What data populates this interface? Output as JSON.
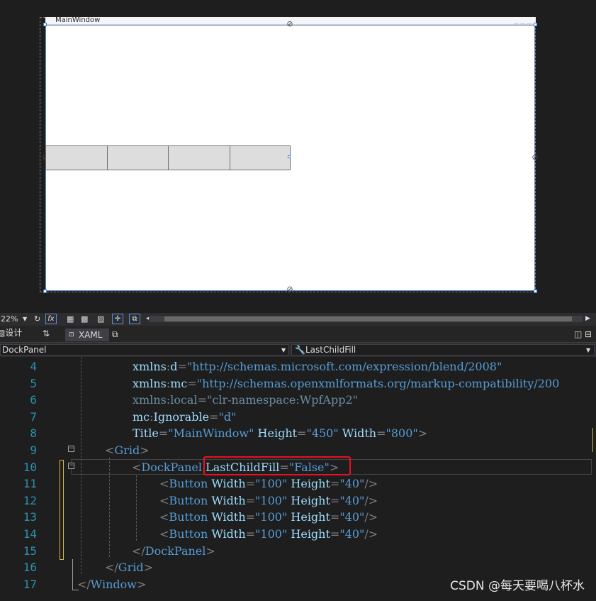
{
  "designer": {
    "window_title": "MainWindow",
    "buttons": [
      "",
      "",
      "",
      ""
    ]
  },
  "toolbar": {
    "zoom": "22%",
    "fx_label": "fx"
  },
  "tabs": {
    "design_label": "设计",
    "swap_label": "⇅",
    "xaml_label": "XAML"
  },
  "navbar": {
    "element_combo": "DockPanel",
    "member_combo": "LastChildFill"
  },
  "editor": {
    "line_numbers": [
      "4",
      "5",
      "6",
      "7",
      "8",
      "9",
      "10",
      "11",
      "12",
      "13",
      "14",
      "15",
      "16",
      "17"
    ],
    "lines": [
      {
        "p1": "xmlns",
        "c": ":",
        "p2": "d",
        "eq": "=",
        "v": "\"http://schemas.microsoft.com/expression/blend/2008\""
      },
      {
        "p1": "xmlns",
        "c": ":",
        "p2": "mc",
        "eq": "=",
        "v": "\"http://schemas.openxmlformats.org/markup-compatibility/200"
      },
      {
        "p1": "xmlns",
        "c": ":",
        "p2": "local",
        "eq": "=",
        "v": "\"clr-namespace:WpfApp2\""
      },
      {
        "p1": "mc",
        "c": ":",
        "p2": "Ignorable",
        "eq": "=",
        "v": "\"d\""
      },
      {
        "a1": "Title",
        "v1": "\"MainWindow\"",
        "a2": "Height",
        "v2": "\"450\"",
        "a3": "Width",
        "v3": "\"800\"",
        "end": ">"
      },
      {
        "open": "<",
        "tag": "Grid",
        "close": ">"
      },
      {
        "open": "<",
        "tag": "DockPanel",
        "attr": "LastChildFill",
        "eq": "=",
        "v": "\"False\"",
        "close": ">"
      },
      {
        "open": "<",
        "tag": "Button",
        "a1": "Width",
        "v1": "\"100\"",
        "a2": "Height",
        "v2": "\"40\"",
        "close": "/>"
      },
      {
        "open": "<",
        "tag": "Button",
        "a1": "Width",
        "v1": "\"100\"",
        "a2": "Height",
        "v2": "\"40\"",
        "close": "/>"
      },
      {
        "open": "<",
        "tag": "Button",
        "a1": "Width",
        "v1": "\"100\"",
        "a2": "Height",
        "v2": "\"40\"",
        "close": "/>"
      },
      {
        "open": "<",
        "tag": "Button",
        "a1": "Width",
        "v1": "\"100\"",
        "a2": "Height",
        "v2": "\"40\"",
        "close": "/>"
      },
      {
        "open": "</",
        "tag": "DockPanel",
        "close": ">"
      },
      {
        "open": "</",
        "tag": "Grid",
        "close": ">"
      },
      {
        "open": "</",
        "tag": "Window",
        "close": ">"
      }
    ]
  },
  "watermark": "CSDN @每天要喝八杯水",
  "colors": {
    "tag": "#569cd6",
    "attr": "#9cdcfe",
    "line_number": "#2b91af",
    "highlight": "#e81123"
  }
}
